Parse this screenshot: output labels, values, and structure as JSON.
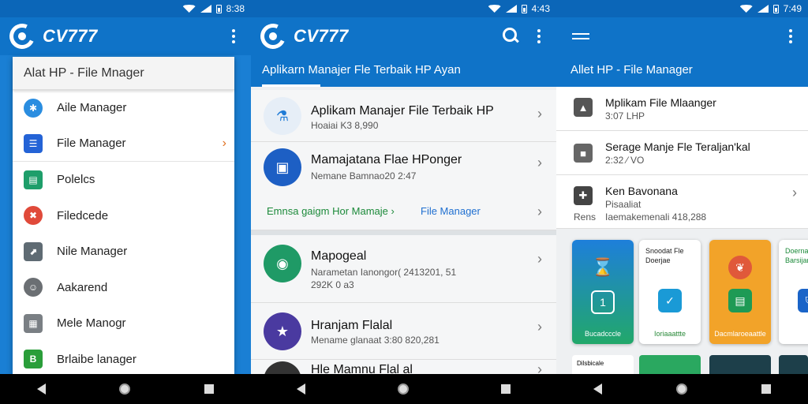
{
  "status": {
    "time_1": "8:38",
    "time_2": "4:43",
    "time_3": "7:49"
  },
  "brand": {
    "name": "CV777"
  },
  "panel1": {
    "drawer_title": "Alat HP - File Mnager",
    "items": [
      {
        "label": "Aile Manager",
        "icon": "gear-icon",
        "color": "#2a8de0"
      },
      {
        "label": "File Manager",
        "icon": "file-list-icon",
        "color": "#2463d6"
      },
      {
        "label": "Polelcs",
        "icon": "document-icon",
        "color": "#1e9e6a"
      },
      {
        "label": "Filedcede",
        "icon": "alert-face-icon",
        "color": "#e04a3a"
      },
      {
        "label": "Nile Manager",
        "icon": "folder-arrow-icon",
        "color": "#5f6b73"
      },
      {
        "label": "Aakarend",
        "icon": "user-icon",
        "color": "#6b6f73"
      },
      {
        "label": "Mele Manogr",
        "icon": "grid-icon",
        "color": "#7a7f84"
      },
      {
        "label": "Brlaibe lanager",
        "icon": "storage-icon",
        "color": "#2a9e3a"
      }
    ]
  },
  "panel2": {
    "tab_label": "Aplikarn Manajer Fle Terbaik HP Ayan",
    "rows": [
      {
        "title": "Aplikam Manajer File Terbaik HP",
        "sub": "Hoaiai K3 8,990",
        "icon": "flask-icon",
        "color": "#1f7bd6"
      },
      {
        "title": "Mamajatana Flae HPonger",
        "sub": "Nemane Bamnao20 2:47",
        "icon": "folder-image-icon",
        "color": "#1d5fc4"
      },
      {
        "prefix": "Emnsa gaigm Hor Mamaje ›",
        "link": "File Manager"
      },
      {
        "title": "Mapogeal",
        "sub": "Narametan Ianongor( 2413201, 51",
        "sub2": "292K 0 a3",
        "icon": "chat-icon",
        "color": "#1f9a66"
      },
      {
        "title": "Hranjam Flalal",
        "sub": "Mename glanaat 3:80 820,281",
        "icon": "folder-star-icon",
        "color": "#4a3aa0"
      },
      {
        "title": "Hle Mamnu Flal al",
        "icon": "disc-icon",
        "color": "#333"
      }
    ]
  },
  "panel3": {
    "subheader": "Allet HP - File Manager",
    "rows": [
      {
        "title": "Mplikam File Mlaanger",
        "sub": "3:07 LHP",
        "icon": "upload-icon",
        "color": "#555"
      },
      {
        "title": "Serage Manje Fle Teraljan'kal",
        "sub": "2:32 ⁄ VO",
        "icon": "square-icon",
        "color": "#666"
      },
      {
        "title": "Ken Bavonana",
        "sub": "Pisaaliat",
        "sub2": "Iaemakemenali 418,288",
        "left_label": "Rens",
        "icon": "grid-x-icon",
        "color": "#444"
      }
    ],
    "cards": [
      {
        "top": "",
        "bottom": "Bucadcccle",
        "bg": "#1f7fd9",
        "icon": "hourglass-icon"
      },
      {
        "top": "Snoodat Fle Doerjae",
        "bottom": "Ioriaaattte",
        "bg": "#ffffff",
        "icon": "check-badge-icon"
      },
      {
        "top": "",
        "bottom": "Dacmlaroeaattle",
        "bg": "#f2a329",
        "icon": "leaf-icon"
      },
      {
        "top": "Doernale Barsijan",
        "bottom": "",
        "bg": "#ffffff",
        "icon": "shield-icon"
      }
    ],
    "mini_text": "Dilsbicale"
  }
}
